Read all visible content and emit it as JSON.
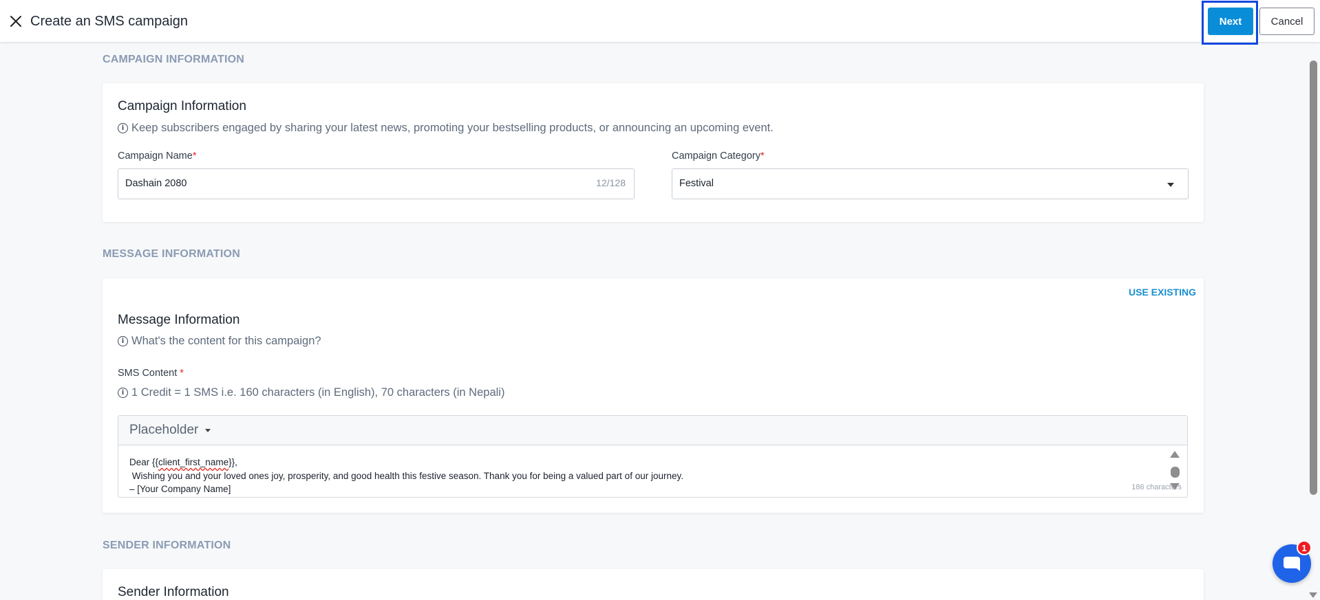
{
  "header": {
    "title": "Create an SMS campaign",
    "next_label": "Next",
    "cancel_label": "Cancel"
  },
  "sections": {
    "campaign": "CAMPAIGN INFORMATION",
    "message": "MESSAGE INFORMATION",
    "sender": "SENDER INFORMATION"
  },
  "campaign_card": {
    "title": "Campaign Information",
    "subtitle": "Keep subscribers engaged by sharing your latest news, promoting your bestselling products, or announcing an upcoming event.",
    "name_label": "Campaign Name",
    "name_value": "Dashain 2080",
    "name_counter": "12/128",
    "category_label": "Campaign Category",
    "category_value": "Festival",
    "required_mark": "*"
  },
  "message_card": {
    "use_existing": "USE EXISTING",
    "title": "Message Information",
    "subtitle": "What's the content for this campaign?",
    "sms_label": "SMS Content",
    "required_mark": "*",
    "credit_note": "1 Credit = 1 SMS i.e. 160 characters (in English), 70 characters (in Nepali)",
    "placeholder_label": "Placeholder",
    "sms_line1_prefix": "Dear {{",
    "sms_line1_token": "client_first_name",
    "sms_line1_suffix": "}},",
    "sms_line2": " Wishing you and your loved ones joy, prosperity, and good health this festive season. Thank you for being a valued part of our journey.",
    "sms_line3": "– [Your Company Name]",
    "char_count": "186 characters"
  },
  "sender_card": {
    "title": "Sender Information"
  },
  "chat": {
    "badge_count": "1"
  },
  "colors": {
    "primary": "#0a8dd8",
    "highlight": "#1346e0",
    "section_label": "#8b9bb3",
    "chat": "#1f63e8",
    "badge": "#ee1c25"
  }
}
